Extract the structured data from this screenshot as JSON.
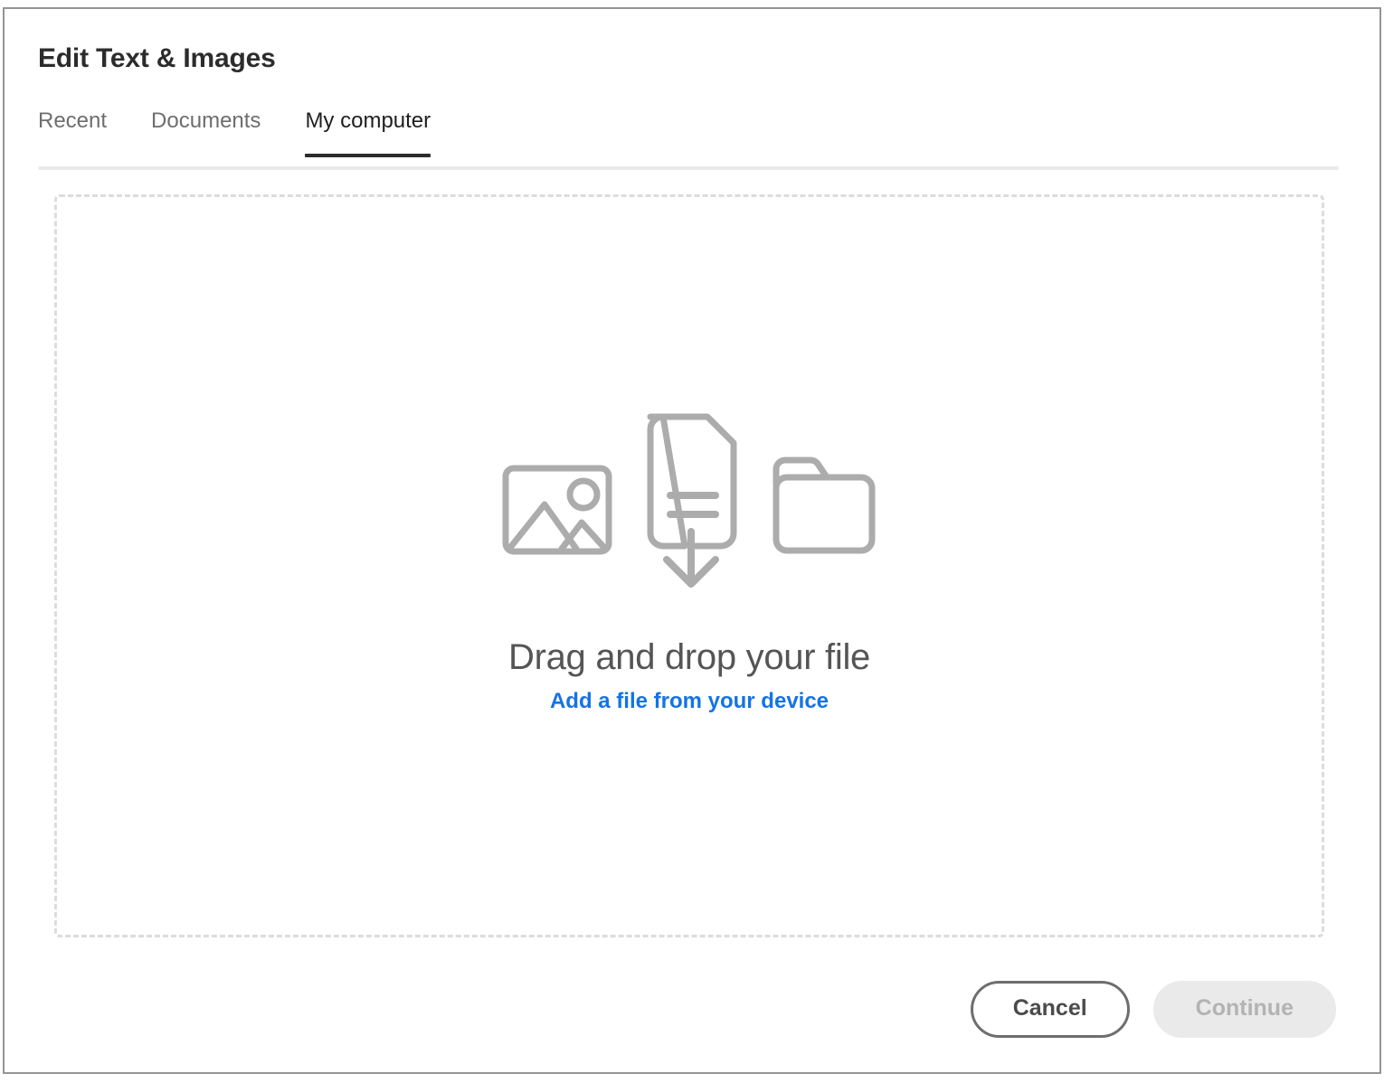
{
  "window": {
    "title": "Edit Text & Images"
  },
  "tabs": [
    {
      "label": "Recent",
      "active": false
    },
    {
      "label": "Documents",
      "active": false
    },
    {
      "label": "My computer",
      "active": true
    }
  ],
  "dropzone": {
    "heading": "Drag and drop your file",
    "link_label": "Add a file from your device",
    "icons": {
      "image": "image-icon",
      "document": "document-download-icon",
      "folder": "folder-icon"
    }
  },
  "footer": {
    "cancel_label": "Cancel",
    "continue_label": "Continue",
    "continue_disabled": true
  },
  "colors": {
    "link_blue": "#1473E6",
    "icon_gray": "#ACACAC",
    "border_gray": "#959595",
    "dashed_gray": "#DCDCDC",
    "tab_active": "#1F1F1F",
    "tab_inactive": "#6E6E6E",
    "disabled_bg": "#EAEAEA",
    "disabled_text": "#B3B3B3"
  }
}
